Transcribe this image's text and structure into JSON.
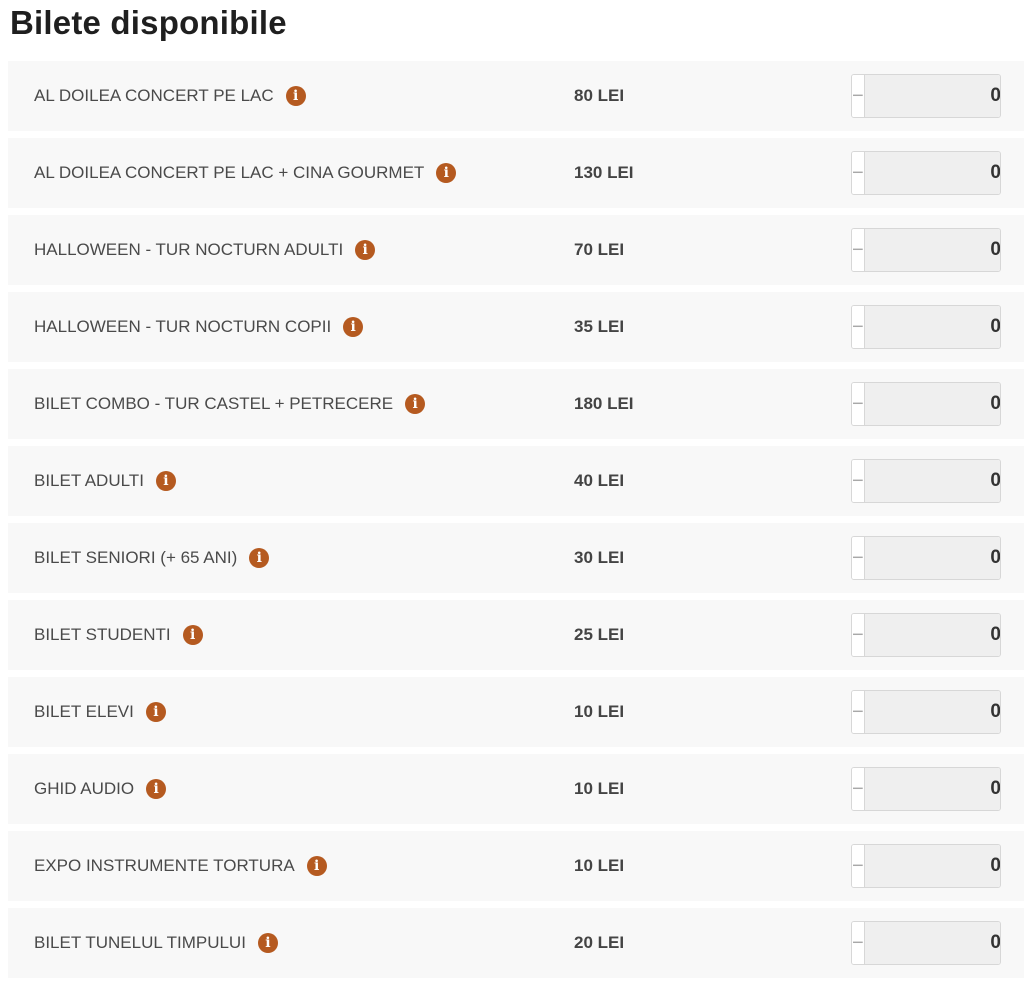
{
  "page": {
    "title": "Bilete disponibile"
  },
  "icons": {
    "info": "info-icon",
    "minus": "minus-icon",
    "plus": "plus-icon"
  },
  "colors": {
    "info_icon": "#b55a20",
    "row_background": "#f8f8f8"
  },
  "controls": {
    "minus_label": "−",
    "plus_label": "+"
  },
  "tickets": [
    {
      "name": "AL DOILEA CONCERT PE LAC",
      "price": "80 LEI",
      "quantity": "0"
    },
    {
      "name": "AL DOILEA CONCERT PE LAC + CINA GOURMET",
      "price": "130 LEI",
      "quantity": "0"
    },
    {
      "name": "HALLOWEEN - TUR NOCTURN ADULTI",
      "price": "70 LEI",
      "quantity": "0"
    },
    {
      "name": "HALLOWEEN - TUR NOCTURN COPII",
      "price": "35 LEI",
      "quantity": "0"
    },
    {
      "name": "BILET COMBO - TUR CASTEL + PETRECERE",
      "price": "180 LEI",
      "quantity": "0"
    },
    {
      "name": "BILET ADULTI",
      "price": "40 LEI",
      "quantity": "0"
    },
    {
      "name": "BILET SENIORI (+ 65 ANI)",
      "price": "30 LEI",
      "quantity": "0"
    },
    {
      "name": "BILET STUDENTI",
      "price": "25 LEI",
      "quantity": "0"
    },
    {
      "name": "BILET ELEVI",
      "price": "10 LEI",
      "quantity": "0"
    },
    {
      "name": "GHID AUDIO",
      "price": "10 LEI",
      "quantity": "0"
    },
    {
      "name": "EXPO INSTRUMENTE TORTURA",
      "price": "10 LEI",
      "quantity": "0"
    },
    {
      "name": "BILET TUNELUL TIMPULUI",
      "price": "20 LEI",
      "quantity": "0"
    }
  ]
}
